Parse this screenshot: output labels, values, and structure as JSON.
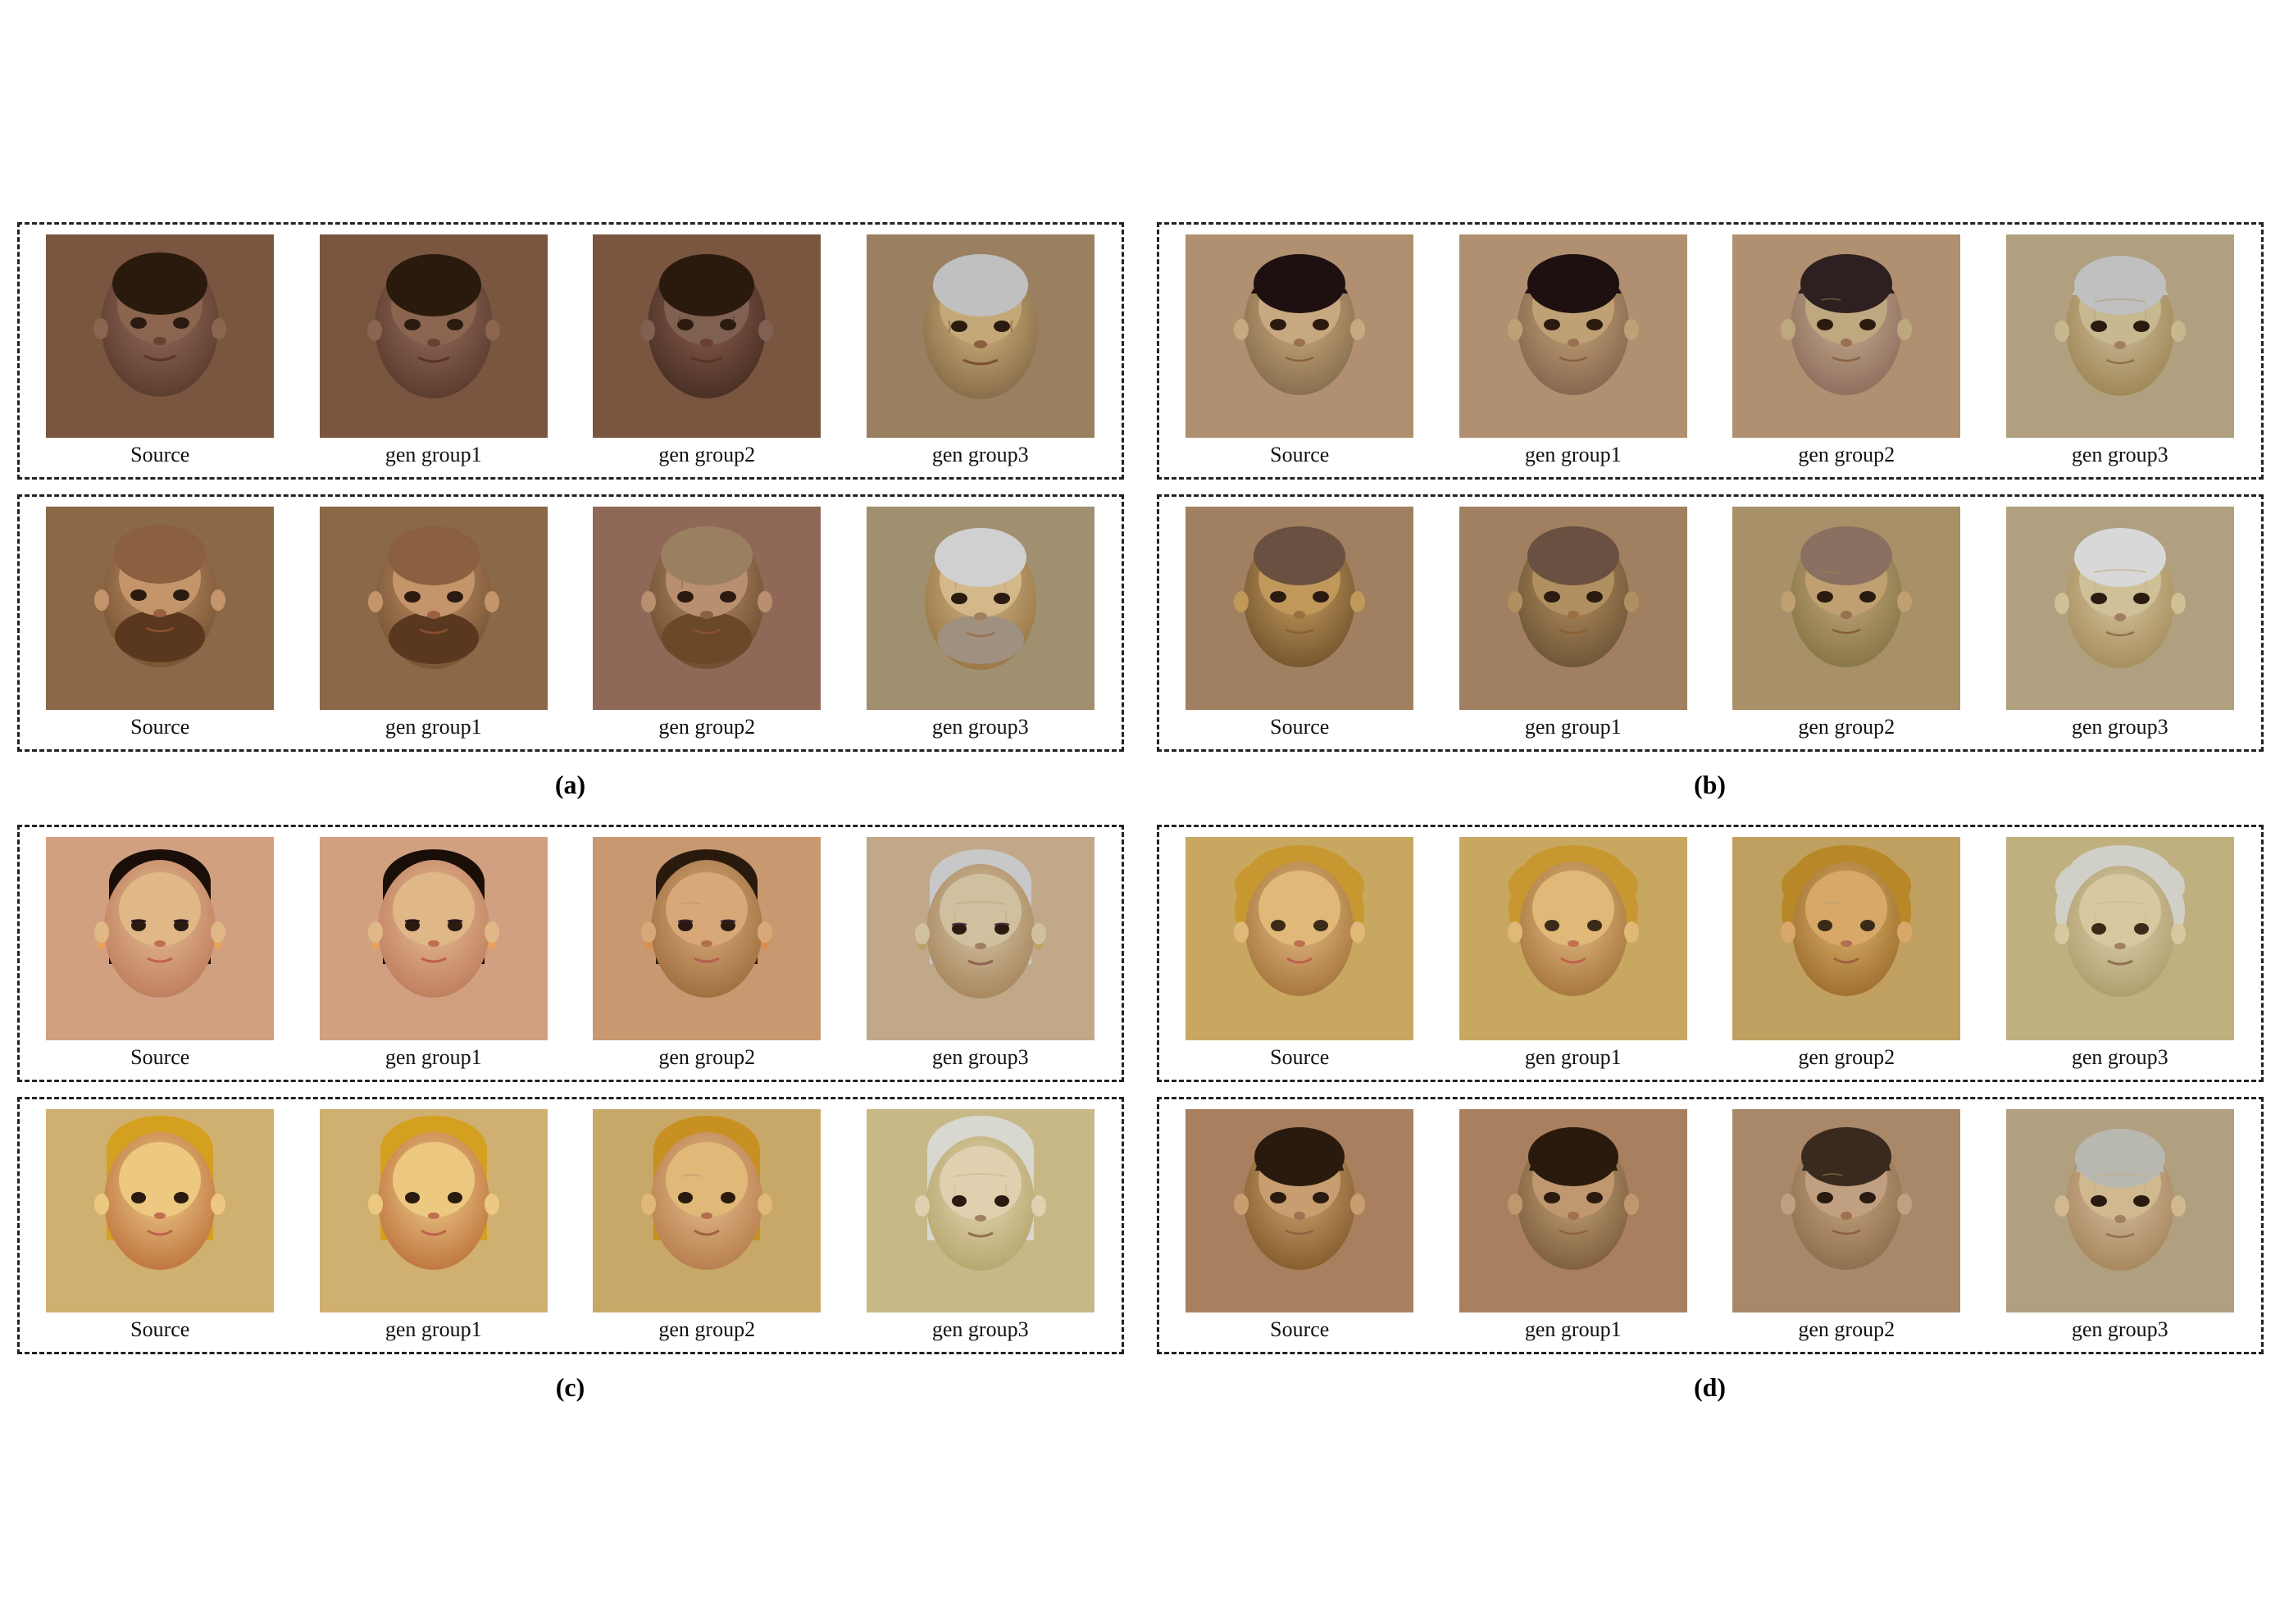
{
  "sections": {
    "a": {
      "label": "(a)",
      "group1": {
        "captions": [
          "Source",
          "gen group1",
          "gen group2",
          "gen group3"
        ],
        "colors": [
          "a1-src",
          "a1-g1",
          "a1-g2",
          "a1-g3"
        ]
      },
      "group2": {
        "captions": [
          "Source",
          "gen group1",
          "gen group2",
          "gen group3"
        ],
        "colors": [
          "a2-src",
          "a2-g1",
          "a2-g2",
          "a2-g3"
        ]
      }
    },
    "b": {
      "label": "(b)",
      "group1": {
        "captions": [
          "Source",
          "gen group1",
          "gen group2",
          "gen group3"
        ],
        "colors": [
          "b1-src",
          "b1-g1",
          "b1-g2",
          "b1-g3"
        ]
      },
      "group2": {
        "captions": [
          "Source",
          "gen group1",
          "gen group2",
          "gen group3"
        ],
        "colors": [
          "b2-src",
          "b2-g1",
          "b2-g2",
          "b2-g3"
        ]
      }
    },
    "c": {
      "label": "(c)",
      "group1": {
        "captions": [
          "Source",
          "gen group1",
          "gen group2",
          "gen group3"
        ],
        "colors": [
          "c1-src",
          "c1-g1",
          "c1-g2",
          "c1-g3"
        ]
      },
      "group2": {
        "captions": [
          "Source",
          "gen group1",
          "gen group2",
          "gen group3"
        ],
        "colors": [
          "c2-src",
          "c2-g1",
          "c2-g2",
          "c2-g3"
        ]
      }
    },
    "d": {
      "label": "(d)",
      "group1": {
        "captions": [
          "Source",
          "gen group1",
          "gen group2",
          "gen group3"
        ],
        "colors": [
          "d1-src",
          "d1-g1",
          "d1-g2",
          "d1-g3"
        ]
      },
      "group2": {
        "captions": [
          "Source",
          "gen group1",
          "gen group2",
          "gen group3"
        ],
        "colors": [
          "d2-src",
          "d2-g1",
          "d2-g2",
          "d2-g3"
        ]
      }
    }
  }
}
